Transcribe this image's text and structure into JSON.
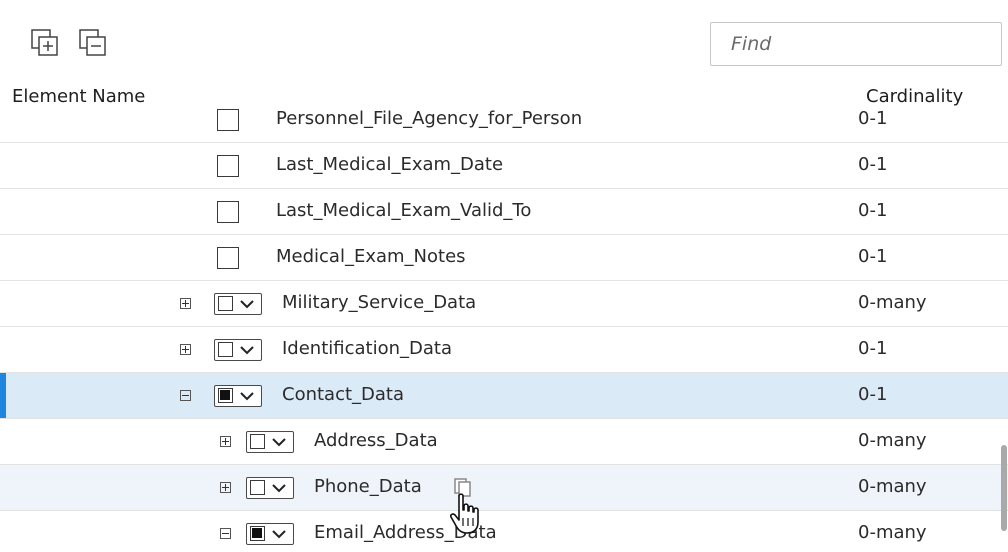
{
  "toolbar": {
    "expand_all_icon": "expand-all-icon",
    "collapse_all_icon": "collapse-all-icon",
    "find_placeholder": "Find"
  },
  "columns": {
    "name": "Element Name",
    "cardinality": "Cardinality"
  },
  "rows": [
    {
      "name": "Personnel_File_Agency_for_Person",
      "cardinality": "0-1"
    },
    {
      "name": "Last_Medical_Exam_Date",
      "cardinality": "0-1"
    },
    {
      "name": "Last_Medical_Exam_Valid_To",
      "cardinality": "0-1"
    },
    {
      "name": "Medical_Exam_Notes",
      "cardinality": "0-1"
    },
    {
      "name": "Military_Service_Data",
      "cardinality": "0-many",
      "expander": "plus",
      "checked": false
    },
    {
      "name": "Identification_Data",
      "cardinality": "0-1",
      "expander": "plus",
      "checked": false
    },
    {
      "name": "Contact_Data",
      "cardinality": "0-1",
      "expander": "minus",
      "checked": true,
      "selected": true
    },
    {
      "name": "Address_Data",
      "cardinality": "0-many",
      "expander": "plus",
      "checked": false
    },
    {
      "name": "Phone_Data",
      "cardinality": "0-many",
      "expander": "plus",
      "checked": false,
      "hover": true
    },
    {
      "name": "Email_Address_Data",
      "cardinality": "0-many",
      "expander": "minus",
      "checked": true
    }
  ],
  "colors": {
    "selected_row": "#dbeaf7",
    "accent": "#1f86e0",
    "hover_row": "#eef4fa"
  }
}
